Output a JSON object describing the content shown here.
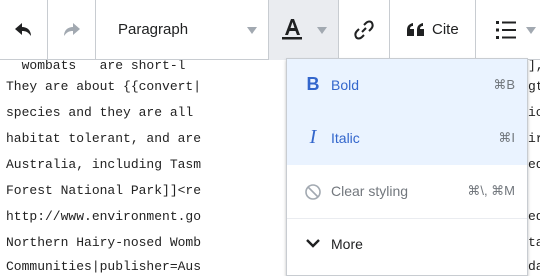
{
  "toolbar": {
    "format_label": "Paragraph",
    "cite_label": "Cite",
    "icons": [
      "undo-icon",
      "redo-icon",
      "chevron-down-icon",
      "text-style-icon",
      "link-icon",
      "quote-icon",
      "bullet-list-icon"
    ]
  },
  "editor_lines": [
    "  wombats   are short-l",
    "They are about {{convert|",
    "species and they are all",
    "habitat tolerant, and are",
    "Australia, including Tasm",
    "Forest National Park]]<re",
    "http://www.environment.go",
    "Northern Hairy-nosed Womb",
    "Communities|publisher=Aus"
  ],
  "editor_right_fragments": [
    "],",
    "gt",
    "ic",
    "ir",
    "ed",
    "ed",
    "ta",
    "da"
  ],
  "menu": {
    "bold": {
      "icon_text": "B",
      "label": "Bold",
      "shortcut": "⌘B"
    },
    "italic": {
      "icon_text": "I",
      "label": "Italic",
      "shortcut": "⌘I"
    },
    "clear": {
      "label": "Clear styling",
      "shortcut": "⌘\\, ⌘M"
    },
    "more": {
      "label": "More"
    }
  },
  "colors": {
    "accent": "#3366cc",
    "disabled": "#72777d",
    "highlight": "#eaf3ff"
  }
}
